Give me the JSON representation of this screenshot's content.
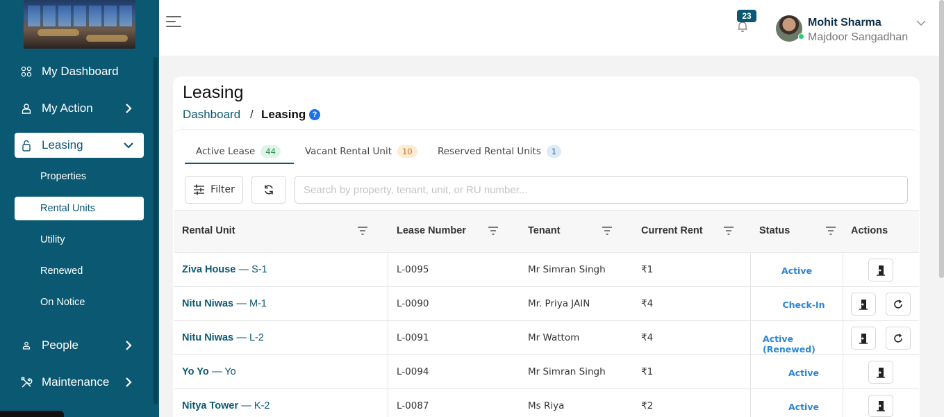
{
  "sidebar": {
    "items": [
      {
        "label": "My Dashboard",
        "icon": "grid-icon"
      },
      {
        "label": "My Action",
        "icon": "user-icon"
      },
      {
        "label": "Leasing",
        "icon": "lock-icon"
      },
      {
        "label": "People",
        "icon": "person-icon"
      },
      {
        "label": "Maintenance",
        "icon": "tools-icon"
      }
    ],
    "sub_items": [
      "Properties",
      "Rental Units",
      "Utility",
      "Renewed",
      "On Notice"
    ]
  },
  "header": {
    "notification_count": "23",
    "user_name": "Mohit Sharma",
    "user_org": "Majdoor Sangadhan"
  },
  "page": {
    "title": "Leasing",
    "breadcrumb": {
      "root": "Dashboard",
      "separator": "/",
      "current": "Leasing",
      "help": "?"
    }
  },
  "tabs": [
    {
      "label": "Active Lease",
      "count": "44",
      "badge_bg": "#dff3e6",
      "badge_color": "#2e8b57"
    },
    {
      "label": "Vacant Rental Unit",
      "count": "10",
      "badge_bg": "#fdebd3",
      "badge_color": "#c77a1e"
    },
    {
      "label": "Reserved Rental Units",
      "count": "1",
      "badge_bg": "#dcebf7",
      "badge_color": "#2a6fa8"
    }
  ],
  "toolbar": {
    "filter_label": "Filter",
    "search_placeholder": "Search by property, tenant, unit, or RU number..."
  },
  "table": {
    "columns": [
      "Rental Unit",
      "Lease Number",
      "Tenant",
      "Current Rent",
      "Status",
      "Actions"
    ],
    "rows": [
      {
        "unit_name": "Ziva House",
        "unit_code": "— S-1",
        "lease": "L-0095",
        "tenant": "Mr Simran Singh",
        "rent": "₹1",
        "status": "Active",
        "renew": false
      },
      {
        "unit_name": "Nitu Niwas",
        "unit_code": "— M-1",
        "lease": "L-0090",
        "tenant": "Mr. Priya JAIN",
        "rent": "₹4",
        "status": "Check-In",
        "renew": true
      },
      {
        "unit_name": "Nitu Niwas",
        "unit_code": "— L-2",
        "lease": "L-0091",
        "tenant": "Mr Wattom",
        "rent": "₹4",
        "status": "Active (Renewed)",
        "renew": true
      },
      {
        "unit_name": "Yo Yo",
        "unit_code": "— Yo",
        "lease": "L-0094",
        "tenant": "Mr Simran Singh",
        "rent": "₹1",
        "status": "Active",
        "renew": false
      },
      {
        "unit_name": "Nitya Tower",
        "unit_code": "— K-2",
        "lease": "L-0087",
        "tenant": "Ms Riya",
        "rent": "₹2",
        "status": "Active",
        "renew": false
      }
    ]
  },
  "colors": {
    "brand": "#0b5872",
    "status": "#2a86d6"
  }
}
